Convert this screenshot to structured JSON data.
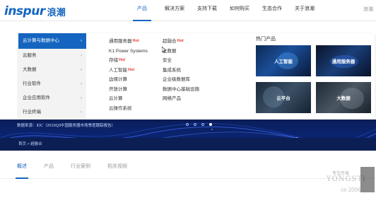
{
  "header": {
    "logo_main": "inspur",
    "logo_cn": "浪潮",
    "nav": [
      "产品",
      "解决方案",
      "支持下载",
      "如何购买",
      "生态合作",
      "关于浪潮"
    ],
    "active_index": 0,
    "right_text": "浪潮"
  },
  "menu": {
    "sidebar": [
      {
        "label": "云计算与数据中心",
        "active": true
      },
      {
        "label": "云服务",
        "active": false
      },
      {
        "label": "大数据",
        "active": false
      },
      {
        "label": "行业软件",
        "active": false
      },
      {
        "label": "企业应用软件",
        "active": false
      },
      {
        "label": "行业终端",
        "active": false
      }
    ],
    "col1": [
      {
        "label": "通用服务器",
        "hot": "Hot"
      },
      {
        "label": "K1 Power Systems",
        "hot": ""
      },
      {
        "label": "存储",
        "hot": "Hot"
      },
      {
        "label": "人工智能",
        "hot": "Hot"
      },
      {
        "label": "边缘计算",
        "hot": ""
      },
      {
        "label": "开放计算",
        "hot": ""
      },
      {
        "label": "云计算",
        "hot": ""
      },
      {
        "label": "云操作系统",
        "hot": ""
      }
    ],
    "col2": [
      {
        "label": "超融合",
        "hot": "Hot"
      },
      {
        "label": "大数据",
        "hot": ""
      },
      {
        "label": "安全",
        "hot": ""
      },
      {
        "label": "集成系统",
        "hot": ""
      },
      {
        "label": "企业级数据库",
        "hot": ""
      },
      {
        "label": "数据中心基础设施",
        "hot": ""
      },
      {
        "label": "网络产品",
        "hot": ""
      }
    ],
    "hot_title": "热门产品",
    "tiles": [
      "人工智能",
      "通用服务器",
      "云平台",
      "大数据"
    ]
  },
  "banner": {
    "text": "数据来源：IDC（2019Q3中国服务器市场季度跟踪报告）",
    "dots": 4,
    "active_dot": 3
  },
  "breadcrumb": "首页 > 超融合",
  "tabs": {
    "items": [
      "概述",
      "产品",
      "行业案例",
      "相关视频"
    ],
    "active_index": 0
  },
  "watermark": {
    "text_en": "YONGSTI",
    "year": "ce 2006",
    "top": "专注开发"
  },
  "colors": {
    "brand": "#1565c0",
    "hot": "#e53935",
    "banner": "#0b2470"
  }
}
